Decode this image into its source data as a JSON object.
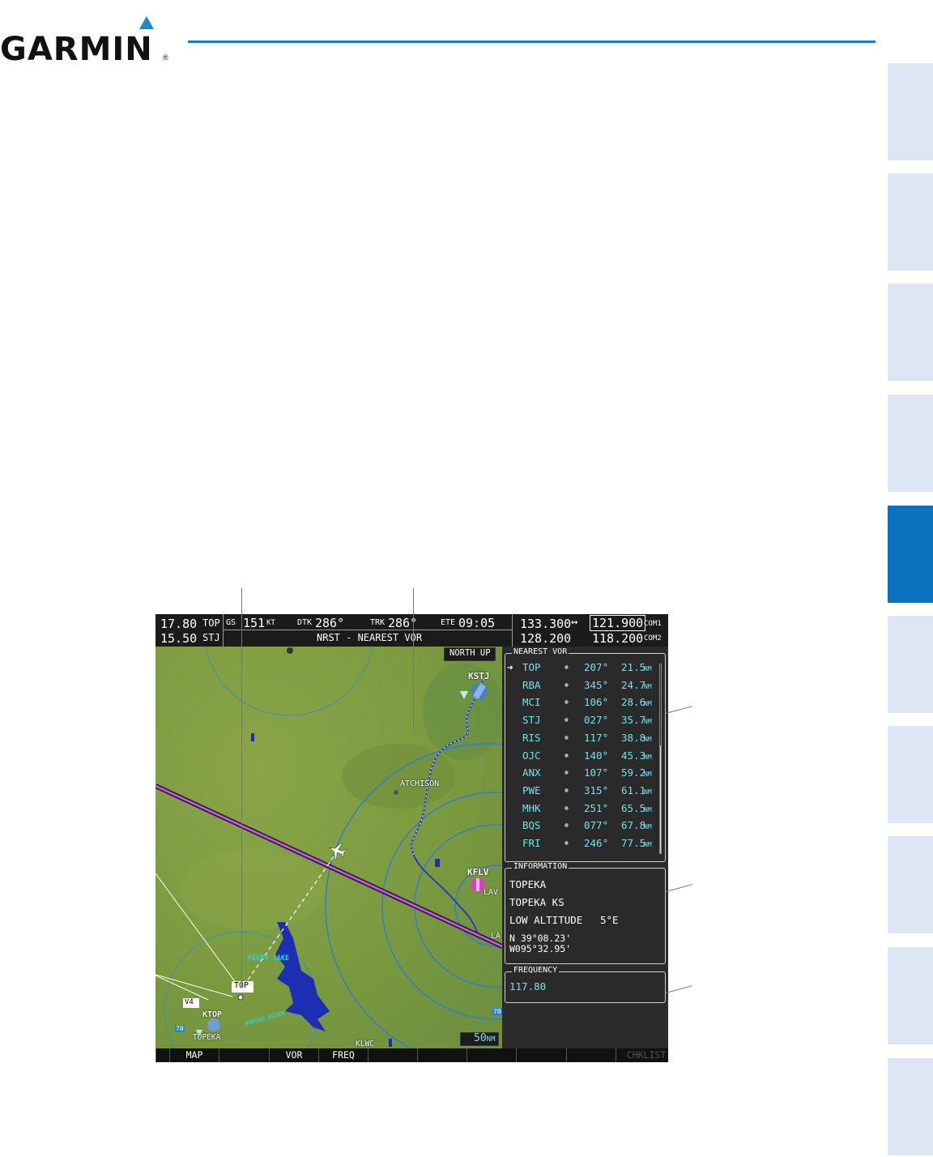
{
  "header": {
    "brand": "GARMIN",
    "reg": "®",
    "accent": "#1a7cc8"
  },
  "side_tabs": {
    "active_index": 4,
    "count": 10
  },
  "screen": {
    "nav": {
      "nav1_freq": "17.80",
      "nav1_id": "TOP",
      "nav2_freq": "15.50",
      "nav2_id": "STJ",
      "gs_label": "GS",
      "gs_value": "151",
      "gs_unit": "KT",
      "dtk_label": "DTK",
      "dtk_value": "286°",
      "trk_label": "TRK",
      "trk_value": "286°",
      "ete_label": "ETE",
      "ete_value": "09:05",
      "page_title": "NRST - NEAREST VOR",
      "com1_active": "133.300",
      "swap": "↔",
      "com1_standby": "121.900",
      "com1_label": "COM1",
      "com2_active": "128.200",
      "com2_standby": "118.200",
      "com2_label": "COM2"
    },
    "map": {
      "orientation": "NORTH UP",
      "range": "50",
      "range_unit": "NM",
      "labels": {
        "kstj": "KSTJ",
        "atchison": "ATCHISON",
        "kflv": "KFLV",
        "top": "TOP",
        "perry_lake": "PERRY LAKE",
        "v4": "V4",
        "ktop": "KTOP",
        "topeka": "TOPEKA",
        "klwc": "KLWC",
        "kansas_river": "KANSAS RIVER",
        "lav": "LAV",
        "la": "LA",
        "hwy70a": "70",
        "hwy70b": "70"
      }
    },
    "nearest_vor": {
      "title": "NEAREST VOR",
      "selected_index": 0,
      "rows": [
        {
          "id": "TOP",
          "brg": "207°",
          "dist": "21.5",
          "unit": "NM"
        },
        {
          "id": "RBA",
          "brg": "345°",
          "dist": "24.7",
          "unit": "NM"
        },
        {
          "id": "MCI",
          "brg": "106°",
          "dist": "28.6",
          "unit": "NM"
        },
        {
          "id": "STJ",
          "brg": "027°",
          "dist": "35.7",
          "unit": "NM"
        },
        {
          "id": "RIS",
          "brg": "117°",
          "dist": "38.8",
          "unit": "NM"
        },
        {
          "id": "OJC",
          "brg": "140°",
          "dist": "45.3",
          "unit": "NM"
        },
        {
          "id": "ANX",
          "brg": "107°",
          "dist": "59.2",
          "unit": "NM"
        },
        {
          "id": "PWE",
          "brg": "315°",
          "dist": "61.1",
          "unit": "NM"
        },
        {
          "id": "MHK",
          "brg": "251°",
          "dist": "65.5",
          "unit": "NM"
        },
        {
          "id": "BQS",
          "brg": "077°",
          "dist": "67.8",
          "unit": "NM"
        },
        {
          "id": "FRI",
          "brg": "246°",
          "dist": "77.5",
          "unit": "NM"
        }
      ]
    },
    "information": {
      "title": "INFORMATION",
      "name": "TOPEKA",
      "city": "TOPEKA KS",
      "class": "LOW ALTITUDE",
      "magvar": "5°E",
      "lat": "N 39°08.23'",
      "lon": "W095°32.95'"
    },
    "frequency": {
      "title": "FREQUENCY",
      "value": "117.80"
    },
    "softkeys": [
      "",
      "MAP",
      "",
      "VOR",
      "FREQ",
      "",
      "",
      "",
      "",
      "",
      "CHKLIST"
    ]
  }
}
